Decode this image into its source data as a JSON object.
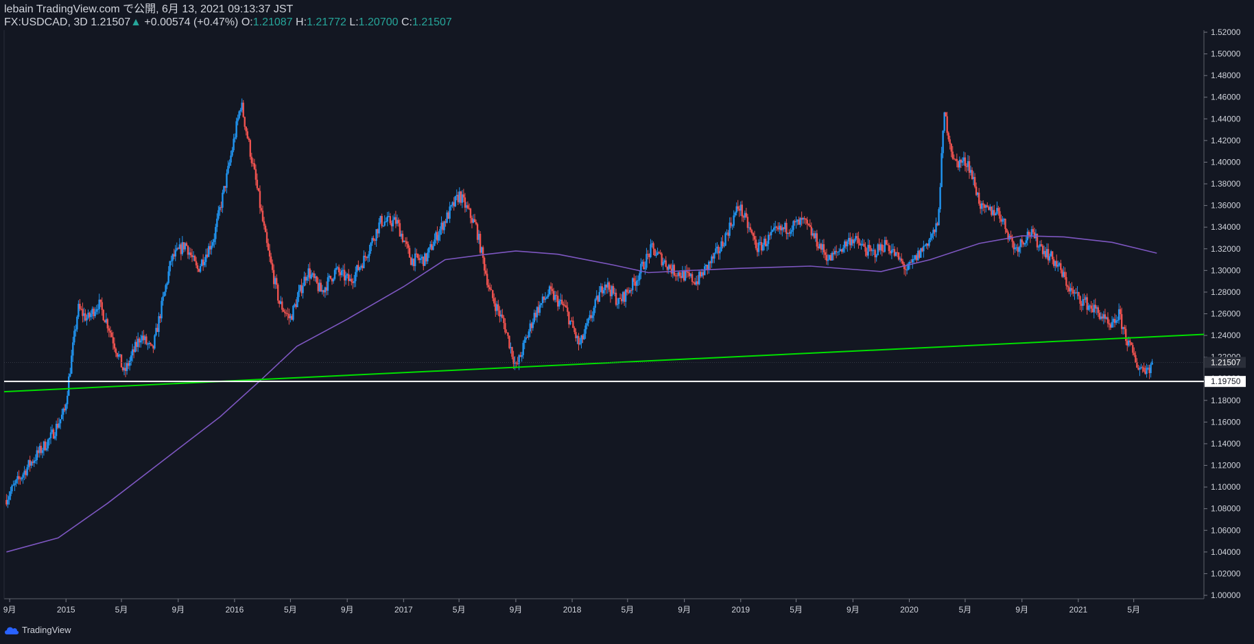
{
  "header": {
    "publisher": "lebain TradingView.com で公開, 6月 13, 2021 09:13:37 JST",
    "symbol": "FX:USDCAD, 3D",
    "last": "1.21507",
    "change_arrow": "▲",
    "change": "+0.00574 (+0.47%)",
    "open_label": "O:",
    "open": "1.21087",
    "high_label": "H:",
    "high": "1.21772",
    "low_label": "L:",
    "low": "1.20700",
    "close_label": "C:",
    "close": "1.21507"
  },
  "logo": {
    "icon": "tradingview-cloud-icon",
    "text": "TradingView"
  },
  "chart_data": {
    "type": "candlestick",
    "ylim": [
      1.0,
      1.52
    ],
    "y_ticks": [
      "1.52000",
      "1.50000",
      "1.48000",
      "1.46000",
      "1.44000",
      "1.42000",
      "1.40000",
      "1.38000",
      "1.36000",
      "1.34000",
      "1.32000",
      "1.30000",
      "1.28000",
      "1.26000",
      "1.24000",
      "1.22000",
      "1.20000",
      "1.18000",
      "1.16000",
      "1.14000",
      "1.12000",
      "1.10000",
      "1.08000",
      "1.06000",
      "1.04000",
      "1.02000",
      "1.00000"
    ],
    "y_tick_values": [
      1.52,
      1.5,
      1.48,
      1.46,
      1.44,
      1.42,
      1.4,
      1.38,
      1.36,
      1.34,
      1.32,
      1.3,
      1.28,
      1.26,
      1.24,
      1.22,
      1.2,
      1.18,
      1.16,
      1.14,
      1.12,
      1.1,
      1.08,
      1.06,
      1.04,
      1.02,
      1.0
    ],
    "x_ticks": [
      {
        "label": "9月",
        "date": "2014-09-01"
      },
      {
        "label": "2015",
        "date": "2015-01-01"
      },
      {
        "label": "5月",
        "date": "2015-05-01"
      },
      {
        "label": "9月",
        "date": "2015-09-01"
      },
      {
        "label": "2016",
        "date": "2016-01-01"
      },
      {
        "label": "5月",
        "date": "2016-05-01"
      },
      {
        "label": "9月",
        "date": "2016-09-01"
      },
      {
        "label": "2017",
        "date": "2017-01-01"
      },
      {
        "label": "5月",
        "date": "2017-05-01"
      },
      {
        "label": "9月",
        "date": "2017-09-01"
      },
      {
        "label": "2018",
        "date": "2018-01-01"
      },
      {
        "label": "5月",
        "date": "2018-05-01"
      },
      {
        "label": "9月",
        "date": "2018-09-01"
      },
      {
        "label": "2019",
        "date": "2019-01-01"
      },
      {
        "label": "5月",
        "date": "2019-05-01"
      },
      {
        "label": "9月",
        "date": "2019-09-01"
      },
      {
        "label": "2020",
        "date": "2020-01-01"
      },
      {
        "label": "5月",
        "date": "2020-05-01"
      },
      {
        "label": "9月",
        "date": "2020-09-01"
      },
      {
        "label": "2021",
        "date": "2021-01-01"
      },
      {
        "label": "5月",
        "date": "2021-05-01"
      }
    ],
    "xlim": [
      "2014-08-20",
      "2021-09-30"
    ],
    "price_path": [
      [
        "2014-08-25",
        1.088
      ],
      [
        "2014-10-15",
        1.12
      ],
      [
        "2014-12-01",
        1.145
      ],
      [
        "2015-01-01",
        1.17
      ],
      [
        "2015-01-30",
        1.265
      ],
      [
        "2015-02-20",
        1.255
      ],
      [
        "2015-03-15",
        1.27
      ],
      [
        "2015-04-05",
        1.25
      ],
      [
        "2015-05-10",
        1.205
      ],
      [
        "2015-06-15",
        1.24
      ],
      [
        "2015-07-10",
        1.225
      ],
      [
        "2015-08-20",
        1.31
      ],
      [
        "2015-09-20",
        1.325
      ],
      [
        "2015-10-15",
        1.3
      ],
      [
        "2015-11-20",
        1.33
      ],
      [
        "2015-12-20",
        1.39
      ],
      [
        "2016-01-18",
        1.455
      ],
      [
        "2016-02-20",
        1.38
      ],
      [
        "2016-03-15",
        1.32
      ],
      [
        "2016-04-10",
        1.27
      ],
      [
        "2016-05-03",
        1.255
      ],
      [
        "2016-06-10",
        1.3
      ],
      [
        "2016-07-10",
        1.28
      ],
      [
        "2016-08-10",
        1.3
      ],
      [
        "2016-09-10",
        1.29
      ],
      [
        "2016-10-10",
        1.31
      ],
      [
        "2016-11-15",
        1.345
      ],
      [
        "2016-12-20",
        1.345
      ],
      [
        "2017-01-20",
        1.31
      ],
      [
        "2017-02-20",
        1.31
      ],
      [
        "2017-03-20",
        1.335
      ],
      [
        "2017-05-05",
        1.37
      ],
      [
        "2017-06-10",
        1.34
      ],
      [
        "2017-07-10",
        1.28
      ],
      [
        "2017-08-10",
        1.25
      ],
      [
        "2017-09-05",
        1.21
      ],
      [
        "2017-10-15",
        1.26
      ],
      [
        "2017-11-15",
        1.28
      ],
      [
        "2017-12-20",
        1.265
      ],
      [
        "2018-01-20",
        1.23
      ],
      [
        "2018-03-15",
        1.29
      ],
      [
        "2018-04-15",
        1.27
      ],
      [
        "2018-05-20",
        1.29
      ],
      [
        "2018-06-25",
        1.32
      ],
      [
        "2018-08-10",
        1.3
      ],
      [
        "2018-10-01",
        1.29
      ],
      [
        "2018-11-20",
        1.32
      ],
      [
        "2018-12-31",
        1.36
      ],
      [
        "2019-02-10",
        1.32
      ],
      [
        "2019-03-20",
        1.335
      ],
      [
        "2019-05-20",
        1.345
      ],
      [
        "2019-07-15",
        1.31
      ],
      [
        "2019-09-01",
        1.33
      ],
      [
        "2019-10-15",
        1.315
      ],
      [
        "2019-11-15",
        1.325
      ],
      [
        "2019-12-31",
        1.3
      ],
      [
        "2020-02-10",
        1.325
      ],
      [
        "2020-03-05",
        1.34
      ],
      [
        "2020-03-20",
        1.445
      ],
      [
        "2020-04-10",
        1.4
      ],
      [
        "2020-05-10",
        1.4
      ],
      [
        "2020-06-10",
        1.355
      ],
      [
        "2020-07-15",
        1.355
      ],
      [
        "2020-08-20",
        1.32
      ],
      [
        "2020-09-20",
        1.335
      ],
      [
        "2020-10-20",
        1.32
      ],
      [
        "2020-11-20",
        1.305
      ],
      [
        "2020-12-20",
        1.28
      ],
      [
        "2021-01-20",
        1.27
      ],
      [
        "2021-02-20",
        1.26
      ],
      [
        "2021-03-15",
        1.245
      ],
      [
        "2021-04-01",
        1.26
      ],
      [
        "2021-04-20",
        1.235
      ],
      [
        "2021-05-15",
        1.21
      ],
      [
        "2021-06-08",
        1.21
      ],
      [
        "2021-06-11",
        1.215
      ]
    ],
    "ma_line": {
      "color": "#7e57c2",
      "points": [
        [
          "2014-08-25",
          1.04
        ],
        [
          "2014-12-15",
          1.053
        ],
        [
          "2015-04-01",
          1.085
        ],
        [
          "2015-08-01",
          1.125
        ],
        [
          "2015-12-01",
          1.165
        ],
        [
          "2016-03-01",
          1.2
        ],
        [
          "2016-05-15",
          1.23
        ],
        [
          "2016-09-01",
          1.255
        ],
        [
          "2017-01-01",
          1.285
        ],
        [
          "2017-04-01",
          1.31
        ],
        [
          "2017-07-01",
          1.315
        ],
        [
          "2017-09-01",
          1.318
        ],
        [
          "2017-12-01",
          1.315
        ],
        [
          "2018-04-01",
          1.305
        ],
        [
          "2018-06-15",
          1.298
        ],
        [
          "2018-09-15",
          1.3
        ],
        [
          "2019-01-01",
          1.302
        ],
        [
          "2019-06-01",
          1.304
        ],
        [
          "2019-11-01",
          1.299
        ],
        [
          "2020-02-15",
          1.31
        ],
        [
          "2020-06-01",
          1.325
        ],
        [
          "2020-09-01",
          1.332
        ],
        [
          "2020-12-01",
          1.331
        ],
        [
          "2021-03-15",
          1.326
        ],
        [
          "2021-06-20",
          1.316
        ]
      ]
    },
    "trendline": {
      "color": "#00e000",
      "points": [
        [
          "2014-08-20",
          1.188
        ],
        [
          "2021-09-30",
          1.241
        ]
      ]
    },
    "horizontal_line": {
      "color": "#ffffff",
      "value": 1.1975,
      "label": "1.19750"
    },
    "last_price": {
      "value": 1.21507,
      "label": "1.21507"
    },
    "colors": {
      "up": "#2196f3",
      "down": "#ef5350",
      "background": "#131722"
    }
  }
}
